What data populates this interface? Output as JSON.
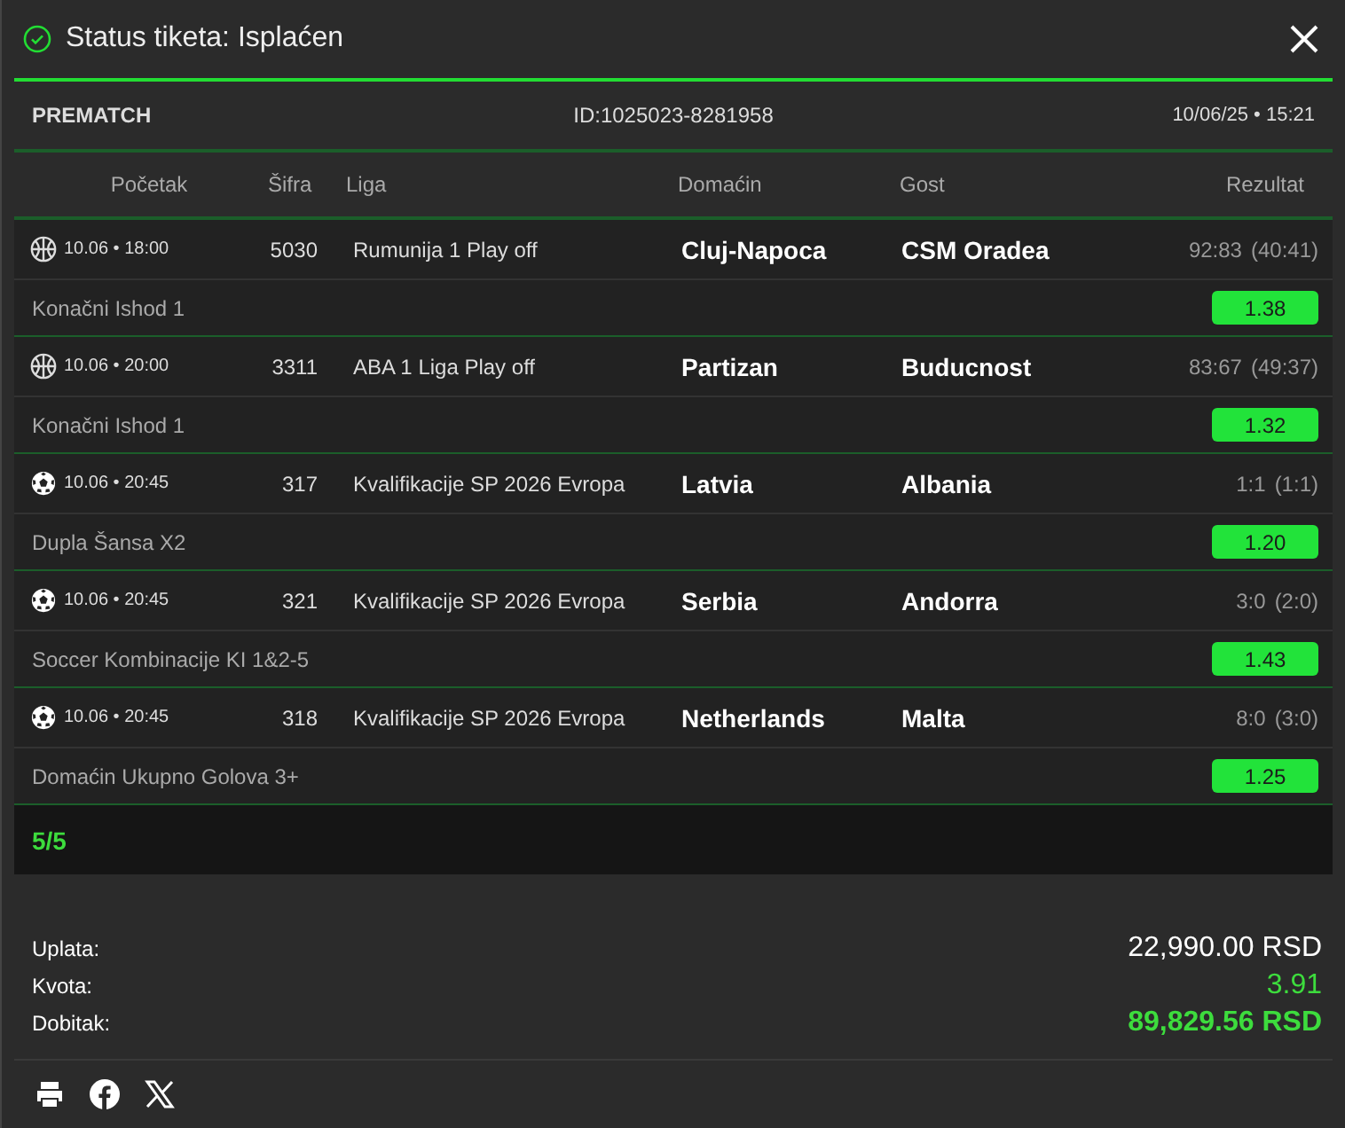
{
  "header": {
    "title": "Status tiketa: Isplaćen",
    "paid": true
  },
  "info": {
    "type": "PREMATCH",
    "id": "ID:1025023-8281958",
    "datetime": "10/06/25 • 15:21"
  },
  "columns": [
    "Početak",
    "Šifra",
    "Liga",
    "Domaćin",
    "Gost",
    "Rezultat"
  ],
  "matches": [
    {
      "kind": "basketball",
      "time": "10.06 • 18:00",
      "code": "5030",
      "league": "Rumunija 1 Play off",
      "home": "Cluj-Napoca",
      "away": "CSM Oradea",
      "score": "92:83",
      "halftime": "(40:41)",
      "pick": "Konačni Ishod 1",
      "odd": "1.38",
      "won": true
    },
    {
      "kind": "basketball",
      "time": "10.06 • 20:00",
      "code": "3311",
      "league": "ABA 1 Liga Play off",
      "home": "Partizan",
      "away": "Buducnost",
      "score": "83:67",
      "halftime": "(49:37)",
      "pick": "Konačni Ishod 1",
      "odd": "1.32",
      "won": true
    },
    {
      "kind": "soccer",
      "time": "10.06 • 20:45",
      "code": "317",
      "league": "Kvalifikacije SP 2026 Evropa",
      "home": "Latvia",
      "away": "Albania",
      "score": "1:1",
      "halftime": "(1:1)",
      "pick": "Dupla Šansa X2",
      "odd": "1.20",
      "won": true
    },
    {
      "kind": "soccer",
      "time": "10.06 • 20:45",
      "code": "321",
      "league": "Kvalifikacije SP 2026 Evropa",
      "home": "Serbia",
      "away": "Andorra",
      "score": "3:0",
      "halftime": "(2:0)",
      "pick": "Soccer Kombinacije KI 1&2-5",
      "odd": "1.43",
      "won": true
    },
    {
      "kind": "soccer",
      "time": "10.06 • 20:45",
      "code": "318",
      "league": "Kvalifikacije SP 2026 Evropa",
      "home": "Netherlands",
      "away": "Malta",
      "score": "8:0",
      "halftime": "(3:0)",
      "pick": "Domaćin Ukupno Golova 3+",
      "odd": "1.25",
      "won": true
    }
  ],
  "hits": "5/5",
  "summary": [
    {
      "label": "Uplata:",
      "value": "22,990.00 RSD",
      "kind": "stake"
    },
    {
      "label": "Kvota:",
      "value": "3.91",
      "kind": "odds"
    },
    {
      "label": "Dobitak:",
      "value": "89,829.56 RSD",
      "kind": "win"
    }
  ]
}
